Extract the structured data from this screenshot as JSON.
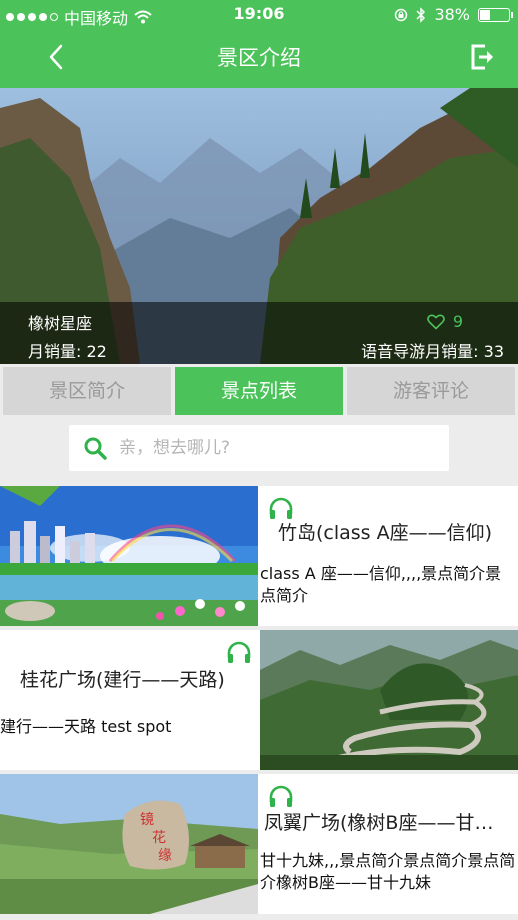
{
  "status_bar": {
    "carrier": "中国移动",
    "time": "19:06",
    "battery": "38%",
    "battery_level": 0.38
  },
  "nav": {
    "title": "景区介绍"
  },
  "banner": {
    "name": "橡树星座",
    "monthly_sales": "月销量: 22",
    "likes": "9",
    "voice_monthly_sales": "语音导游月销量: 33"
  },
  "tabs": [
    {
      "label": "景区简介",
      "active": false
    },
    {
      "label": "景点列表",
      "active": true
    },
    {
      "label": "游客评论",
      "active": false
    }
  ],
  "search": {
    "placeholder": "亲，想去哪儿?"
  },
  "spots": [
    {
      "title": "竹岛(class A座——信仰)",
      "desc": "class A 座——信仰,,,,景点简介景点简介"
    },
    {
      "title": "桂花广场(建行——天路)",
      "desc": "建行——天路  test spot"
    },
    {
      "title": "凤翼广场(橡树B座——甘…",
      "desc": "甘十九妹,,,景点简介景点简介景点简介橡树B座——甘十九妹"
    }
  ],
  "colors": {
    "brand_green": "#4cc25b",
    "tab_inactive": "#d6d6d6",
    "background": "#ececec"
  }
}
